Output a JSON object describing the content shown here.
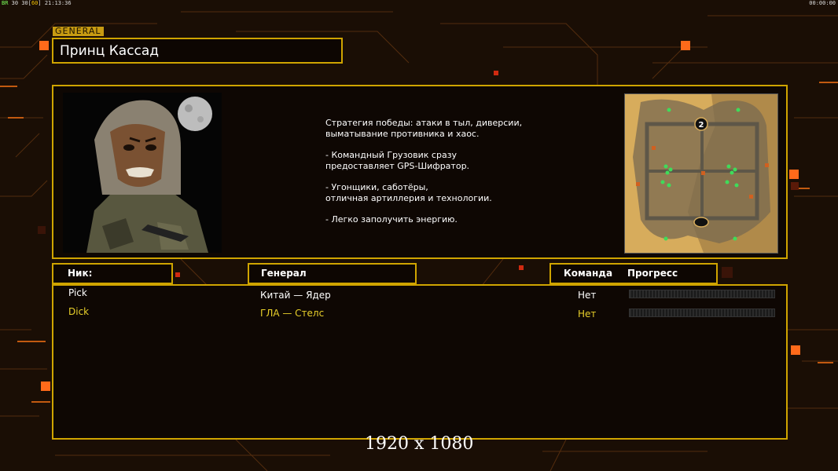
{
  "hud": {
    "top_left_tag": "BR",
    "fps": "30",
    "fps_cap_open": "30[",
    "fps_cap": "60",
    "fps_cap_close": "]",
    "clock": "21:13:36",
    "top_right_timer": "00:00:00"
  },
  "general_tag": "GENERAL",
  "general_name": "Принц Кассад",
  "description": {
    "line1": "Стратегия победы: атаки в тыл, диверсии,",
    "line2": " выматывание противника и хаос.",
    "line3": "- Командный Грузовик сразу",
    "line4": "предоставляет GPS-Шифратор.",
    "line5": "- Угонщики, саботёры,",
    "line6": "отличная артиллерия и технологии.",
    "line7": "- Легко заполучить энергию."
  },
  "map": {
    "start_marker_2": "2"
  },
  "headers": {
    "nick": "Ник:",
    "general": "Генерал",
    "team": "Команда",
    "progress": "Прогресс"
  },
  "players": [
    {
      "nick": "Pick",
      "general": "Китай — Ядер",
      "team": "Нет",
      "color": "#ffffff"
    },
    {
      "nick": "Dick",
      "general": "ГЛА — Стелс",
      "team": "Нет",
      "color": "#e8cf2a"
    }
  ],
  "resolution_label": "1920 x 1080",
  "colors": {
    "accent": "#cfa400",
    "highlight_square": "#ff6a1a"
  }
}
